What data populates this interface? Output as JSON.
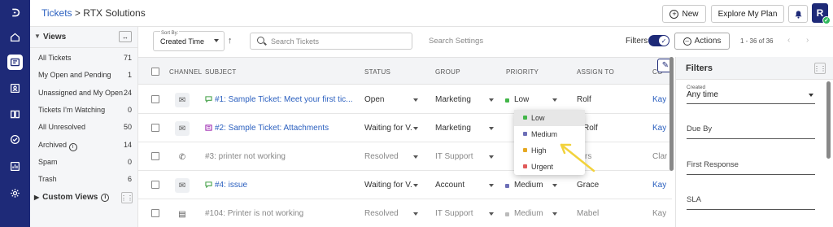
{
  "breadcrumb": {
    "root": "Tickets",
    "separator": " > ",
    "current": "RTX Solutions"
  },
  "header": {
    "new_label": "New",
    "plan_label": "Explore My Plan",
    "avatar_letter": "R"
  },
  "views": {
    "title": "Views",
    "items": [
      {
        "label": "All Tickets",
        "count": "71"
      },
      {
        "label": "My Open and Pending",
        "count": "1"
      },
      {
        "label": "Unassigned and My Open",
        "count": "24"
      },
      {
        "label": "Tickets I'm Watching",
        "count": "0"
      },
      {
        "label": "All Unresolved",
        "count": "50"
      },
      {
        "label": "Archived",
        "count": "14"
      },
      {
        "label": "Spam",
        "count": "0"
      },
      {
        "label": "Trash",
        "count": "6"
      }
    ],
    "custom_views": "Custom Views"
  },
  "toolbar": {
    "sort_label": "Sort By:",
    "sort_value": "Created Time",
    "search_placeholder": "Search Tickets",
    "settings_label": "Search Settings",
    "filters_label": "Filters",
    "actions_label": "Actions",
    "pager": "1 - 36 of 36"
  },
  "columns": [
    "CHANNEL",
    "SUBJECT",
    "STATUS",
    "GROUP",
    "PRIORITY",
    "ASSIGN TO",
    "CO"
  ],
  "rows": [
    {
      "channel": "email",
      "id": "#1:",
      "subject": " Sample Ticket: Meet your first tic...",
      "status": "Open",
      "group": "Marketing",
      "priority": "Low",
      "priority_color": "#43b649",
      "assign": "Rolf",
      "contact": "Kay",
      "muted": false,
      "icon": "chat"
    },
    {
      "channel": "email",
      "id": "#2:",
      "subject": " Sample Ticket: Attachments",
      "status": "Waiting for V...",
      "group": "Marketing",
      "priority": "",
      "priority_color": "",
      "assign": "Rolf",
      "contact": "Kay",
      "muted": false,
      "icon": "media"
    },
    {
      "channel": "phone",
      "id": "#3:",
      "subject": " printer not working",
      "status": "Resolved",
      "group": "IT Support",
      "priority": "",
      "priority_color": "",
      "assign": "rs",
      "contact": "Clar",
      "muted": true,
      "icon": ""
    },
    {
      "channel": "email",
      "id": "#4:",
      "subject": " issue",
      "status": "Waiting for V...",
      "group": "Account",
      "priority": "Medium",
      "priority_color": "#6d6fb7",
      "assign": "Grace",
      "contact": "Kay",
      "muted": false,
      "icon": "chat"
    },
    {
      "channel": "portal",
      "id": "#104:",
      "subject": " Printer is not working",
      "status": "Resolved",
      "group": "IT Support",
      "priority": "Medium",
      "priority_color": "#bbbbbb",
      "assign": "Mabel",
      "contact": "Kay",
      "muted": true,
      "icon": ""
    }
  ],
  "priority_menu": [
    {
      "label": "Low",
      "color": "#43b649",
      "selected": true
    },
    {
      "label": "Medium",
      "color": "#6d6fb7",
      "selected": false
    },
    {
      "label": "High",
      "color": "#e5a823",
      "selected": false
    },
    {
      "label": "Urgent",
      "color": "#e05a5a",
      "selected": false
    }
  ],
  "filters_panel": {
    "title": "Filters",
    "created_label": "Created",
    "created_value": "Any time",
    "due_by": "Due By",
    "first_response": "First Response",
    "sla": "SLA"
  },
  "colors": {
    "rail": "#1e2a78",
    "link": "#2a5fbf",
    "annotation_arrow": "#f2d23c"
  }
}
